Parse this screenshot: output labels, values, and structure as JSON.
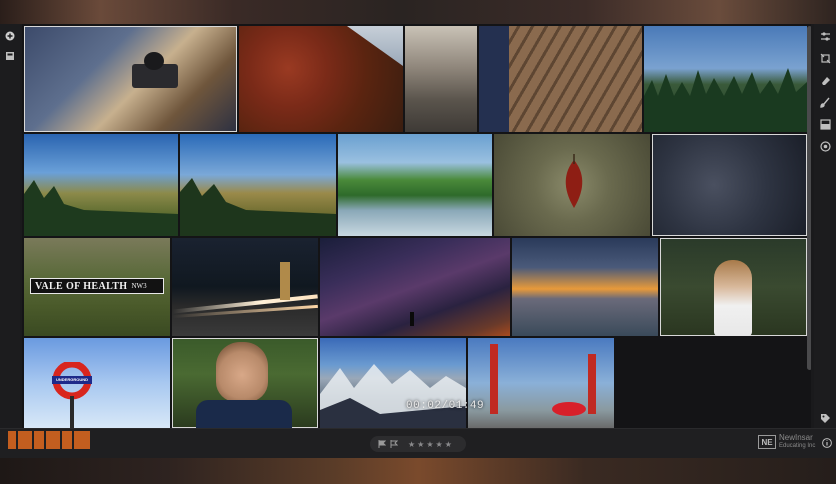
{
  "photo_grid": {
    "tiles": [
      {
        "subject": "person holding camera",
        "selected": true
      },
      {
        "subject": "autumn ivy hillside"
      },
      {
        "subject": "european street"
      },
      {
        "subject": "legs on wooden deck"
      },
      {
        "subject": "mountain pine forest"
      },
      {
        "subject": "hill with pines"
      },
      {
        "subject": "hill with pines alt"
      },
      {
        "subject": "river rocks"
      },
      {
        "subject": "red leaf on branch"
      },
      {
        "subject": "sparkles on stone"
      },
      {
        "subject": "vale of health sign"
      },
      {
        "subject": "night traffic london"
      },
      {
        "subject": "milky way"
      },
      {
        "subject": "sunset beach"
      },
      {
        "subject": "girl portrait ivy"
      },
      {
        "subject": "underground sign"
      },
      {
        "subject": "young man portrait"
      },
      {
        "subject": "snowy mountains"
      },
      {
        "subject": "red sculptures"
      }
    ],
    "sign_text": "VALE OF HEALTH",
    "sign_postcode": "NW3",
    "roundel_text": "UNDERGROUND"
  },
  "video_overlay": {
    "timecode": "00:02/01:49"
  },
  "bottom_bar": {
    "star_rating": "★★★★★",
    "brand_mark": "NE",
    "brand_name": "NewInsar",
    "brand_sub": "Educating Inc"
  },
  "colors": {
    "accent": "#e06a1e",
    "panel": "#1a1a1c",
    "selection": "#d8d8d8"
  }
}
